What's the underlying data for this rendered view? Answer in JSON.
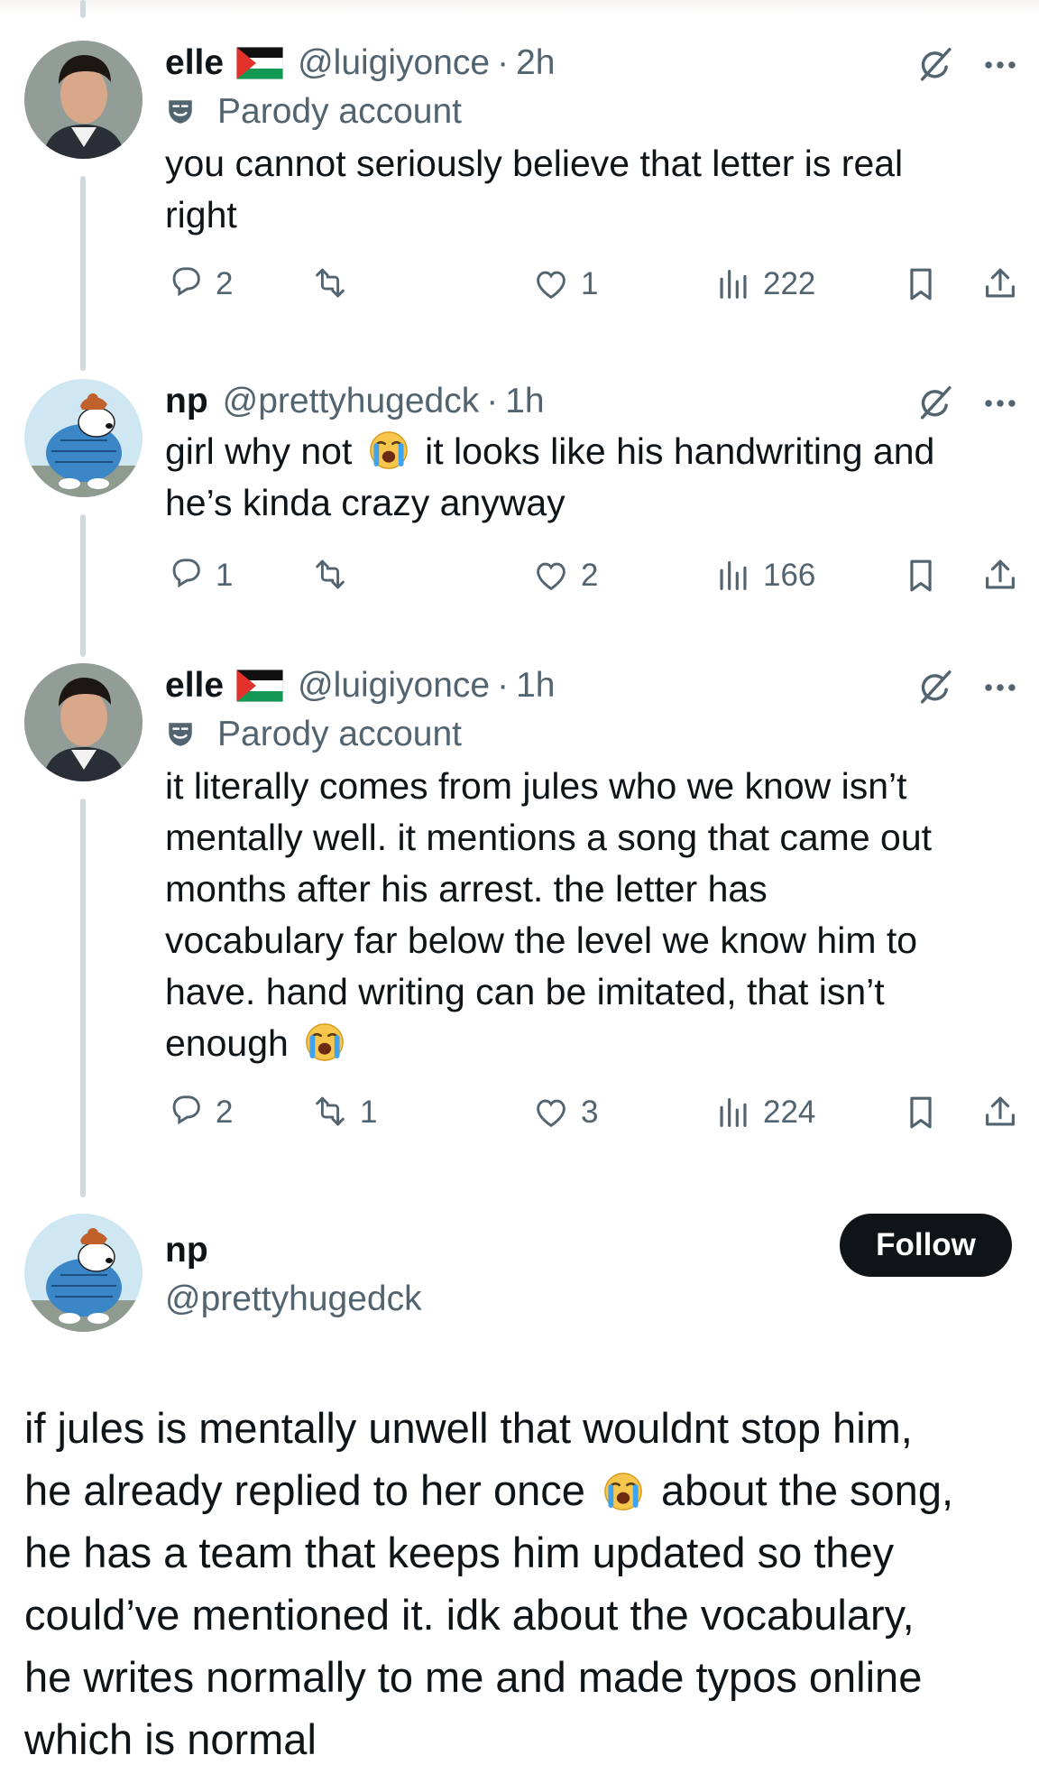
{
  "replies": [
    {
      "name": "elle",
      "handle": "@luigiyonce",
      "time": "2h",
      "flag": "palestine-flag-icon",
      "parody_label": "Parody account",
      "lines": [
        "you cannot seriously believe that letter is real",
        "right"
      ],
      "stats": {
        "replies": "2",
        "reposts": "",
        "likes": "1",
        "views": "222"
      }
    },
    {
      "name": "np",
      "handle": "@prettyhugedck",
      "time": "1h",
      "lines": [
        "girl why not [cry] it looks like his handwriting and",
        "he’s kinda crazy anyway"
      ],
      "stats": {
        "replies": "1",
        "reposts": "",
        "likes": "2",
        "views": "166"
      }
    },
    {
      "name": "elle",
      "handle": "@luigiyonce",
      "time": "1h",
      "parody_label": "Parody account",
      "lines": [
        "it literally comes from jules who we know isn’t",
        "mentally well. it mentions a song that came out",
        "months after his arrest. the letter has",
        "vocabulary far below the level we know him to",
        "have. hand writing can be imitated, that isn’t",
        "enough"
      ],
      "stats": {
        "replies": "2",
        "reposts": "1",
        "likes": "3",
        "views": "224"
      }
    }
  ],
  "main_post": {
    "name": "np",
    "handle": "@prettyhugedck",
    "follow_label": "Follow",
    "lines": [
      "if jules is mentally unwell that wouldnt stop him,",
      "he already replied to her once [cry] about the song,",
      "he has a team that keeps him updated so they",
      "could’ve mentioned it. idk about the vocabulary,",
      "he writes normally to me and made typos online",
      "which is normal"
    ]
  },
  "colors": {
    "text": "#0f1419",
    "secondary": "#536471",
    "thread_line": "#cfd9de",
    "button": "#0f1419"
  },
  "icons": [
    "reply-icon",
    "repost-icon",
    "like-icon",
    "views-icon",
    "bookmark-icon",
    "share-icon",
    "grok-icon",
    "more-icon",
    "parody-mask-icon",
    "loudly-crying-emoji"
  ]
}
